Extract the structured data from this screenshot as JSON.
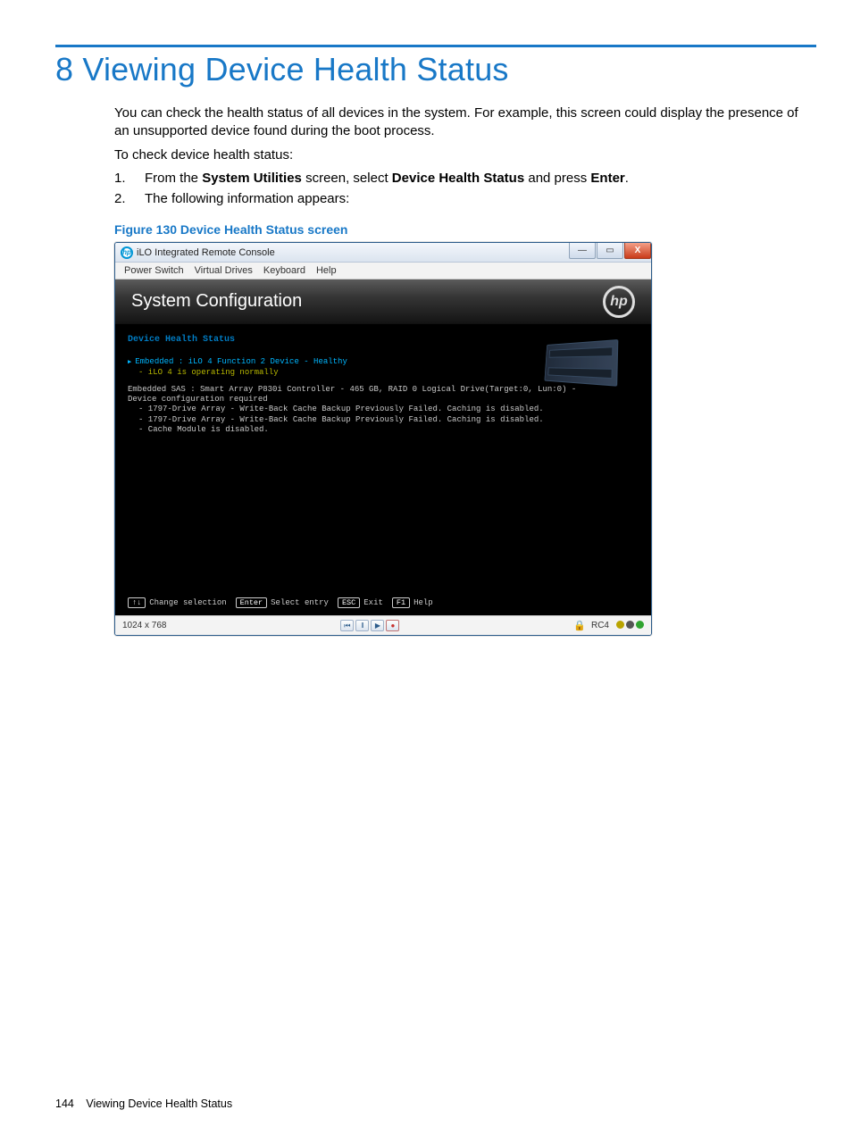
{
  "chapter": {
    "title": "8 Viewing Device Health Status",
    "para1": "You can check the health status of all devices in the system. For example, this screen could display the presence of an unsupported device found during the boot process.",
    "para2": "To check device health status:",
    "step1_pre": "From the ",
    "step1_b1": "System Utilities",
    "step1_mid1": " screen, select ",
    "step1_b2": "Device Health Status",
    "step1_mid2": " and press ",
    "step1_b3": "Enter",
    "step1_post": ".",
    "step2": "The following information appears:",
    "fig_title": "Figure 130 Device Health Status screen"
  },
  "win": {
    "title": "iLO Integrated Remote Console",
    "hp_glyph": "hp",
    "btn_min": "—",
    "btn_max": "▭",
    "btn_close": "X",
    "menu": [
      "Power Switch",
      "Virtual Drives",
      "Keyboard",
      "Help"
    ],
    "sysconf": "System Configuration",
    "devhealth_title": "Device Health Status",
    "line_sel": "Embedded : iLO 4 Function 2 Device - Healthy",
    "line_sel_sub": "- iLO 4 is operating normally",
    "block2_l1": "Embedded SAS : Smart Array P830i Controller - 465 GB, RAID 0 Logical Drive(Target:0, Lun:0) -",
    "block2_l2": "Device configuration required",
    "block2_l3": "- 1797-Drive Array  - Write-Back Cache Backup Previously Failed. Caching is disabled.",
    "block2_l4": "- 1797-Drive Array  - Write-Back Cache Backup Previously Failed. Caching is disabled.",
    "block2_l5": "- Cache Module is disabled.",
    "keys": {
      "updown": "↑↓",
      "updown_lbl": "Change selection",
      "enter": "Enter",
      "enter_lbl": "Select entry",
      "esc": "ESC",
      "esc_lbl": "Exit",
      "f1": "F1",
      "f1_lbl": "Help"
    },
    "status": {
      "res": "1024 x 768",
      "rc": "RC4",
      "play": "▶",
      "rew": "⏮",
      "pause": "‖",
      "rec": "●",
      "lock": "🔒"
    }
  },
  "footer": {
    "page": "144",
    "section": "Viewing Device Health Status"
  }
}
